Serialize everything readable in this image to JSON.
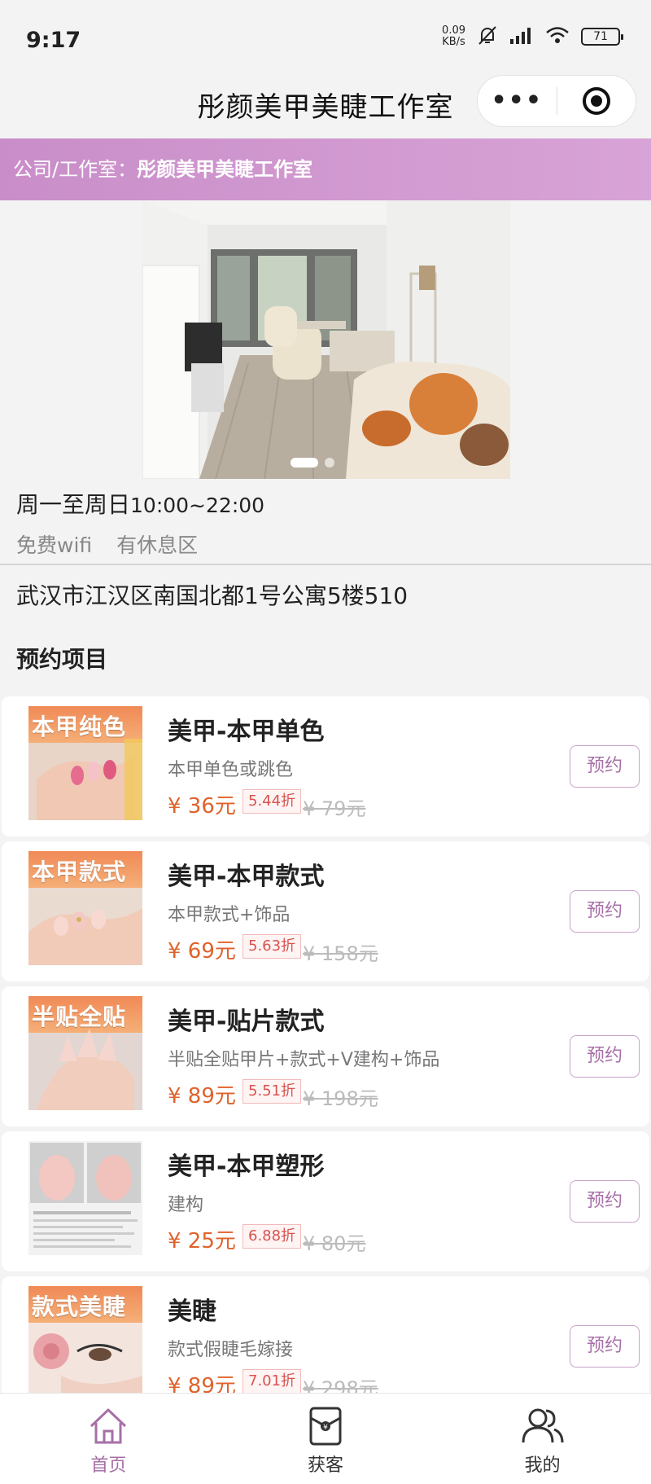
{
  "status_bar": {
    "time": "9:17",
    "speed_value": "0.09",
    "speed_unit": "KB/s",
    "battery": "71",
    "icons": [
      "mute-bell-icon",
      "signal-icon",
      "wifi-icon",
      "battery-icon"
    ]
  },
  "nav": {
    "title": "彤颜美甲美睫工作室",
    "more_label": "•••"
  },
  "company": {
    "label": "公司/工作室：",
    "name": "彤颜美甲美睫工作室"
  },
  "shop": {
    "hours_label": "周一至周日",
    "hours_time": "10:00~22:00",
    "facilities": [
      "免费wifi",
      "有休息区"
    ],
    "address": "武汉市江汉区南国北都1号公寓5楼510",
    "section_title": "预约项目"
  },
  "services": [
    {
      "thumb_title": "本甲纯色",
      "name": "美甲-本甲单色",
      "desc": "本甲单色或跳色",
      "price": "¥ 36元",
      "discount": "5.44折",
      "original": "¥ 79元",
      "button": "预约"
    },
    {
      "thumb_title": "本甲款式",
      "name": "美甲-本甲款式",
      "desc": "本甲款式+饰品",
      "price": "¥ 69元",
      "discount": "5.63折",
      "original": "¥ 158元",
      "button": "预约"
    },
    {
      "thumb_title": "半贴全贴",
      "name": "美甲-贴片款式",
      "desc": "半贴全贴甲片+款式+V建构+饰品",
      "price": "¥ 89元",
      "discount": "5.51折",
      "original": "¥ 198元",
      "button": "预约"
    },
    {
      "thumb_title": "",
      "name": "美甲-本甲塑形",
      "desc": "建构",
      "price": "¥ 25元",
      "discount": "6.88折",
      "original": "¥ 80元",
      "button": "预约"
    },
    {
      "thumb_title": "款式美睫",
      "name": "美睫",
      "desc": "款式假睫毛嫁接",
      "price": "¥ 89元",
      "discount": "7.01折",
      "original": "¥ 298元",
      "button": "预约"
    }
  ],
  "tabbar": {
    "items": [
      {
        "label": "首页",
        "icon": "home-icon",
        "active": true
      },
      {
        "label": "获客",
        "icon": "wallet-icon",
        "active": false
      },
      {
        "label": "我的",
        "icon": "users-icon",
        "active": false
      }
    ]
  },
  "colors": {
    "accent": "#a76fa7",
    "company_bar": "#d39fd2",
    "price": "#e0622b",
    "discount": "#d9534f"
  }
}
